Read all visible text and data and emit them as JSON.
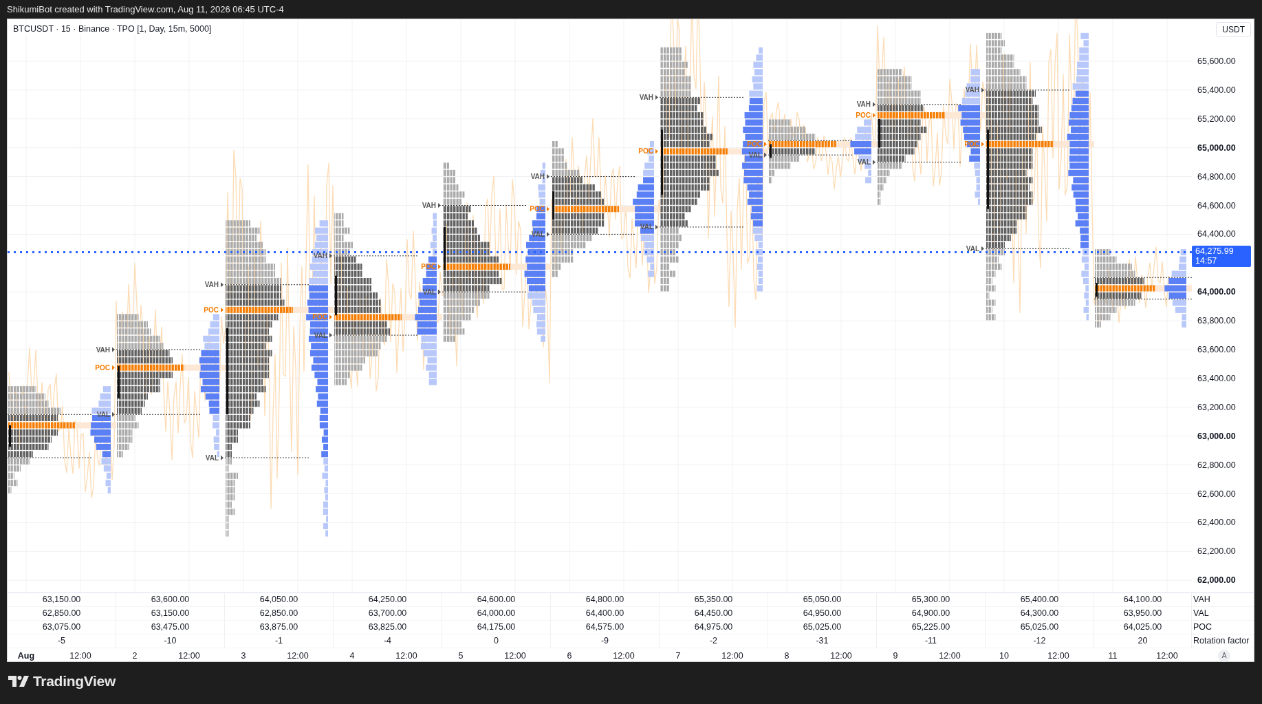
{
  "header": {
    "caption": "ShikumiBot created with TradingView.com, Aug 11, 2026 06:45 UTC-4"
  },
  "chart": {
    "legend": "BTCUSDT · 15 · Binance · TPO [1, Day, 15m, 5000]",
    "currency": "USDT",
    "price_axis": [
      {
        "text": "65,600.00",
        "major": false
      },
      {
        "text": "65,400.00",
        "major": false
      },
      {
        "text": "65,200.00",
        "major": false
      },
      {
        "text": "65,000.00",
        "major": true
      },
      {
        "text": "64,800.00",
        "major": false
      },
      {
        "text": "64,600.00",
        "major": false
      },
      {
        "text": "64,400.00",
        "major": false
      },
      {
        "text": "64,000.00",
        "major": true
      },
      {
        "text": "63,800.00",
        "major": false
      },
      {
        "text": "63,600.00",
        "major": false
      },
      {
        "text": "63,400.00",
        "major": false
      },
      {
        "text": "63,200.00",
        "major": false
      },
      {
        "text": "63,000.00",
        "major": true
      },
      {
        "text": "62,800.00",
        "major": false
      },
      {
        "text": "62,600.00",
        "major": false
      },
      {
        "text": "62,400.00",
        "major": false
      },
      {
        "text": "62,200.00",
        "major": false
      },
      {
        "text": "62,000.00",
        "major": true
      }
    ],
    "last_price": {
      "price": "64,275.99",
      "countdown": "14:57"
    },
    "sessions": [
      {
        "vah": "63,150.00",
        "val": "62,850.00",
        "poc": "63,075.00",
        "rotation": "-5"
      },
      {
        "vah": "63,600.00",
        "val": "63,150.00",
        "poc": "63,475.00",
        "rotation": "-10",
        "markers": {
          "vah": "VAH",
          "poc": "POC",
          "val": "VAL"
        }
      },
      {
        "vah": "64,050.00",
        "val": "62,850.00",
        "poc": "63,875.00",
        "rotation": "-1",
        "markers": {
          "vah": "VAH",
          "poc": "POC",
          "val": "VAL"
        }
      },
      {
        "vah": "64,250.00",
        "val": "63,700.00",
        "poc": "63,825.00",
        "rotation": "-4",
        "markers": {
          "vah": "VAH",
          "poc": "POC",
          "val": "VAL"
        }
      },
      {
        "vah": "64,600.00",
        "val": "64,000.00",
        "poc": "64,175.00",
        "rotation": "0",
        "markers": {
          "vah": "VAH",
          "poc": "POC",
          "val": "VAL"
        }
      },
      {
        "vah": "64,800.00",
        "val": "64,400.00",
        "poc": "64,575.00",
        "rotation": "-9",
        "markers": {
          "vah": "VAH",
          "poc": "POC",
          "val": "VAL"
        }
      },
      {
        "vah": "65,350.00",
        "val": "64,450.00",
        "poc": "64,975.00",
        "rotation": "-2",
        "markers": {
          "vah": "VAH",
          "poc": "POC",
          "val": "VAL"
        }
      },
      {
        "vah": "65,050.00",
        "val": "64,950.00",
        "poc": "65,025.00",
        "rotation": "-31",
        "markers": {
          "poc": "POC",
          "val": "VAL"
        }
      },
      {
        "vah": "65,300.00",
        "val": "64,900.00",
        "poc": "65,225.00",
        "rotation": "-11",
        "markers": {
          "vah": "VAH",
          "poc": "POC",
          "val": "VAL"
        }
      },
      {
        "vah": "65,400.00",
        "val": "64,300.00",
        "poc": "65,025.00",
        "rotation": "-12",
        "markers": {
          "vah": "VAH",
          "poc": "POC",
          "val": "VAL"
        }
      },
      {
        "vah": "64,100.00",
        "val": "63,950.00",
        "poc": "64,025.00",
        "rotation": "20"
      }
    ],
    "table_labels": [
      "VAH",
      "VAL",
      "POC",
      "Rotation factor"
    ],
    "time_axis": [
      {
        "label": "Aug",
        "kind": "month"
      },
      {
        "label": "12:00",
        "kind": "time"
      },
      {
        "label": "2",
        "kind": "day"
      },
      {
        "label": "12:00",
        "kind": "time"
      },
      {
        "label": "3",
        "kind": "day"
      },
      {
        "label": "12:00",
        "kind": "time"
      },
      {
        "label": "4",
        "kind": "day"
      },
      {
        "label": "12:00",
        "kind": "time"
      },
      {
        "label": "5",
        "kind": "day"
      },
      {
        "label": "12:00",
        "kind": "time"
      },
      {
        "label": "6",
        "kind": "day"
      },
      {
        "label": "12:00",
        "kind": "time"
      },
      {
        "label": "7",
        "kind": "day"
      },
      {
        "label": "12:00",
        "kind": "time"
      },
      {
        "label": "8",
        "kind": "day"
      },
      {
        "label": "12:00",
        "kind": "time"
      },
      {
        "label": "9",
        "kind": "day"
      },
      {
        "label": "12:00",
        "kind": "time"
      },
      {
        "label": "10",
        "kind": "day"
      },
      {
        "label": "12:00",
        "kind": "time"
      },
      {
        "label": "11",
        "kind": "day"
      },
      {
        "label": "12:00",
        "kind": "time"
      }
    ],
    "auto_scale": "A"
  },
  "footer": {
    "brand": "TradingView"
  }
}
